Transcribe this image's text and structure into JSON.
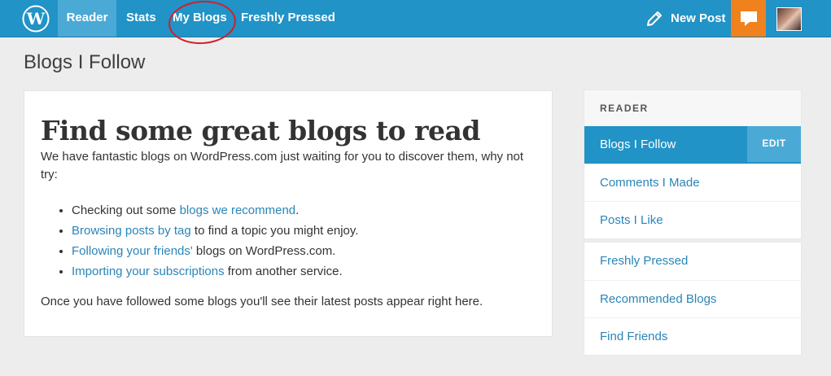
{
  "topbar": {
    "logo_icon": "wordpress-logo",
    "nav": [
      {
        "label": "Reader",
        "active": true
      },
      {
        "label": "Stats",
        "active": false
      },
      {
        "label": "My Blogs",
        "active": false
      },
      {
        "label": "Freshly Pressed",
        "active": false
      }
    ],
    "new_post_label": "New Post",
    "new_post_icon": "pencil-icon",
    "notifications_icon": "speech-bubble-icon",
    "accent_color": "#2193c6",
    "notifications_color": "#f0821e",
    "annotation": {
      "shape": "circle",
      "color": "#d21f2b",
      "target": "My Blogs"
    }
  },
  "page": {
    "title": "Blogs I Follow"
  },
  "main": {
    "heading": "Find some great blogs to read",
    "intro": "We have fantastic blogs on WordPress.com just waiting for you to discover them, why not try:",
    "list": [
      {
        "before": "Checking out some ",
        "link": "blogs we recommend",
        "after": "."
      },
      {
        "before": "",
        "link": "Browsing posts by tag",
        "after": " to find a topic you might enjoy."
      },
      {
        "before": "",
        "link": "Following your friends'",
        "after": " blogs on WordPress.com."
      },
      {
        "before": "",
        "link": "Importing your subscriptions",
        "after": " from another service."
      }
    ],
    "outro": "Once you have followed some blogs you'll see their latest posts appear right here."
  },
  "sidebar": {
    "header": "READER",
    "group1": [
      {
        "label": "Blogs I Follow",
        "active": true,
        "edit_label": "EDIT"
      },
      {
        "label": "Comments I Made",
        "active": false
      },
      {
        "label": "Posts I Like",
        "active": false
      }
    ],
    "group2": [
      {
        "label": "Freshly Pressed"
      },
      {
        "label": "Recommended Blogs"
      },
      {
        "label": "Find Friends"
      }
    ]
  }
}
